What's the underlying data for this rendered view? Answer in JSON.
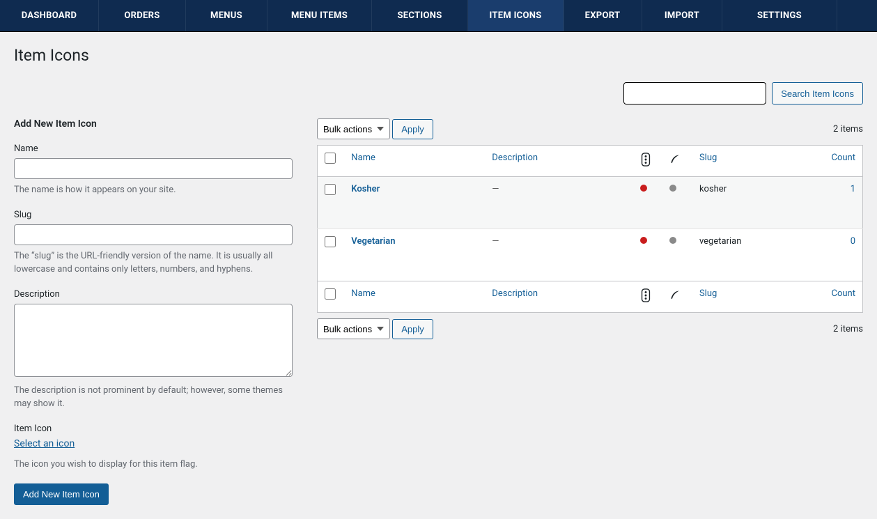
{
  "nav": {
    "items": [
      {
        "label": "DASHBOARD"
      },
      {
        "label": "ORDERS"
      },
      {
        "label": "MENUS"
      },
      {
        "label": "MENU ITEMS"
      },
      {
        "label": "SECTIONS"
      },
      {
        "label": "ITEM ICONS",
        "active": true
      },
      {
        "label": "EXPORT"
      },
      {
        "label": "IMPORT"
      },
      {
        "label": "SETTINGS"
      }
    ]
  },
  "page": {
    "title": "Item Icons"
  },
  "form": {
    "heading": "Add New Item Icon",
    "name": {
      "label": "Name",
      "value": "",
      "desc": "The name is how it appears on your site."
    },
    "slug": {
      "label": "Slug",
      "value": "",
      "desc": "The “slug” is the URL-friendly version of the name. It is usually all lowercase and contains only letters, numbers, and hyphens."
    },
    "description": {
      "label": "Description",
      "value": "",
      "desc": "The description is not prominent by default; however, some themes may show it."
    },
    "icon": {
      "label": "Item Icon",
      "select_link": "Select an icon",
      "desc": "The icon you wish to display for this item flag."
    },
    "submit": "Add New Item Icon"
  },
  "search": {
    "value": "",
    "button": "Search Item Icons"
  },
  "bulk": {
    "selected": "Bulk actions",
    "apply": "Apply"
  },
  "list": {
    "count_text": "2 items",
    "columns": {
      "name": "Name",
      "description": "Description",
      "slug": "Slug",
      "count": "Count"
    },
    "rows": [
      {
        "name": "Kosher",
        "description": "—",
        "slug": "kosher",
        "count": "1"
      },
      {
        "name": "Vegetarian",
        "description": "—",
        "slug": "vegetarian",
        "count": "0"
      }
    ]
  }
}
